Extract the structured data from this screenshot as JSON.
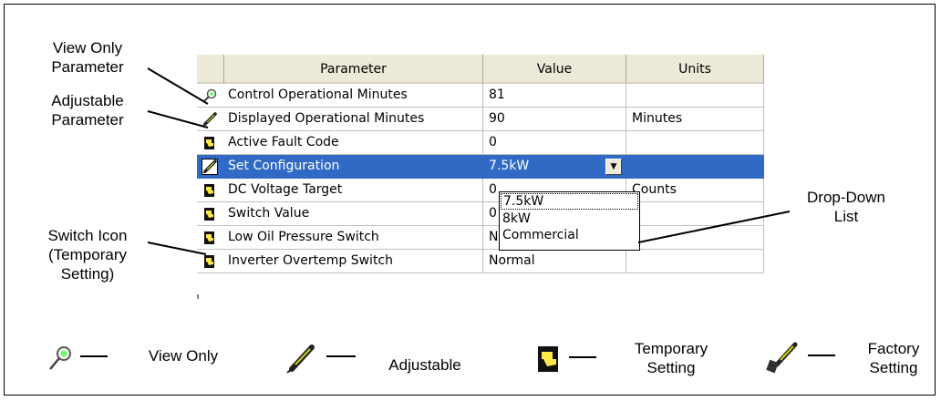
{
  "callouts": {
    "view_only_parameter": [
      "View Only",
      "Parameter"
    ],
    "adjustable_parameter": [
      "Adjustable",
      "Parameter"
    ],
    "switch_icon": [
      "Switch Icon",
      "(Temporary",
      "Setting)"
    ],
    "drop_down_list": [
      "Drop-Down",
      "List"
    ]
  },
  "grid": {
    "columns": [
      "Parameter",
      "Value",
      "Units"
    ],
    "rows": [
      {
        "icon": "view-only-icon",
        "parameter": "Control Operational Minutes",
        "value": "81",
        "units": ""
      },
      {
        "icon": "adjustable-icon",
        "parameter": "Displayed Operational Minutes",
        "value": "90",
        "units": "Minutes"
      },
      {
        "icon": "temporary-setting-icon",
        "parameter": "Active Fault Code",
        "value": "0",
        "units": ""
      },
      {
        "icon": "adjustable-icon",
        "parameter": "Set Configuration",
        "value": "7.5kW",
        "units": "",
        "selected": true
      },
      {
        "icon": "temporary-setting-icon",
        "parameter": "DC Voltage Target",
        "value": "0",
        "units": "Counts"
      },
      {
        "icon": "temporary-setting-icon",
        "parameter": "Switch Value",
        "value": "0",
        "units": ""
      },
      {
        "icon": "temporary-setting-icon",
        "parameter": "Low Oil Pressure Switch",
        "value": "Normal",
        "units": ""
      },
      {
        "icon": "temporary-setting-icon",
        "parameter": "Inverter Overtemp Switch",
        "value": "Normal",
        "units": ""
      }
    ],
    "dropdown_options": [
      "7.5kW",
      "8kW",
      "Commercial"
    ]
  },
  "legend": {
    "view_only": "View Only",
    "adjustable": "Adjustable",
    "temporary_setting": [
      "Temporary",
      "Setting"
    ],
    "factory_setting": [
      "Factory",
      "Setting"
    ]
  },
  "colors": {
    "selection": "#316ac5",
    "header": "#ece9d8",
    "temp_icon_yellow": "#ffe84a"
  }
}
